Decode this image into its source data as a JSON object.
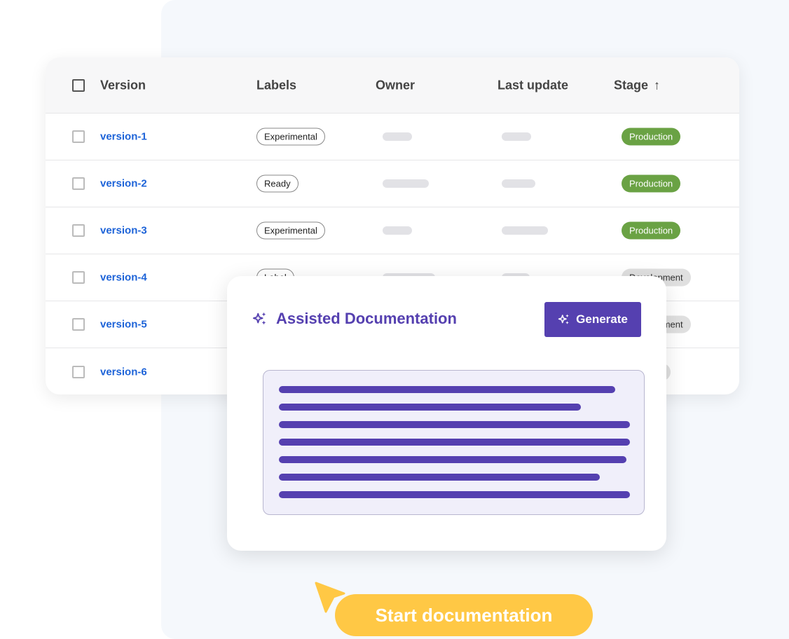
{
  "table": {
    "columns": [
      "Version",
      "Labels",
      "Owner",
      "Last update",
      "Stage"
    ],
    "sort_icon": "arrow-up-icon",
    "rows": [
      {
        "version": "version-1",
        "label": "Experimental",
        "stage": "Production"
      },
      {
        "version": "version-2",
        "label": "Ready",
        "stage": "Production"
      },
      {
        "version": "version-3",
        "label": "Experimental",
        "stage": "Production"
      },
      {
        "version": "version-4",
        "label": "Label",
        "stage": "Development"
      },
      {
        "version": "version-5",
        "label": "",
        "stage": "Development"
      },
      {
        "version": "version-6",
        "label": "",
        "stage": "Planned"
      }
    ]
  },
  "card": {
    "title": "Assisted Documentation",
    "icon": "sparkles-icon",
    "generate_label": "Generate",
    "text_lines_fill": [
      0.88,
      0.79,
      0.92,
      0.92,
      0.91,
      0.84,
      0.92
    ]
  },
  "cta": {
    "label": "Start documentation"
  },
  "colors": {
    "accent": "#5540b0",
    "link": "#1d63d8",
    "production": "#6aa244",
    "cta": "#ffc845"
  }
}
